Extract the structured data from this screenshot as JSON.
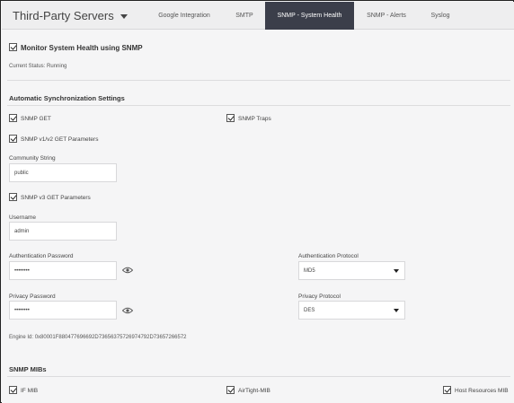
{
  "header": {
    "app_title": "Third-Party Servers",
    "tabs": [
      {
        "label": "Google Integration"
      },
      {
        "label": "SMTP"
      },
      {
        "label": "SNMP - System Health"
      },
      {
        "label": "SNMP - Alerts"
      },
      {
        "label": "Syslog"
      }
    ],
    "active_tab_color": "#3b3e4a"
  },
  "monitor": {
    "label": "Monitor System Health using SNMP",
    "checked": true,
    "status_text": "Current Status:  Running"
  },
  "auto_sync": {
    "title": "Automatic Synchronization Settings",
    "snmp_get": {
      "label": "SNMP GET",
      "checked": true
    },
    "snmp_traps": {
      "label": "SNMP Traps",
      "checked": true
    },
    "v1v2": {
      "label": "SNMP v1/v2 GET Parameters",
      "checked": true
    },
    "community_label": "Community String",
    "community_value": "public",
    "v3": {
      "label": "SNMP v3 GET Parameters",
      "checked": true
    },
    "username_label": "Username",
    "username_value": "admin",
    "auth_password_label": "Authentication Password",
    "auth_password_value": "••••••••",
    "auth_protocol_label": "Authentication Protocol",
    "auth_protocol_value": "MD5",
    "privacy_password_label": "Privacy Password",
    "privacy_password_value": "••••••••",
    "privacy_protocol_label": "Privacy Protocol",
    "privacy_protocol_value": "DES",
    "engine_id": "Engine Id: 0x80001F880477696692D73656375726974792D73657266572"
  },
  "mibs": {
    "title": "SNMP MIBs",
    "items": [
      {
        "label": "IF MIB",
        "checked": true
      },
      {
        "label": "AirTight-MIB",
        "checked": true
      },
      {
        "label": "Host Resources MIB",
        "checked": true
      }
    ]
  },
  "icons": {
    "dropdown": "chevron-down-icon",
    "show_password": "eye-icon",
    "checkbox": "checkmark-icon"
  }
}
